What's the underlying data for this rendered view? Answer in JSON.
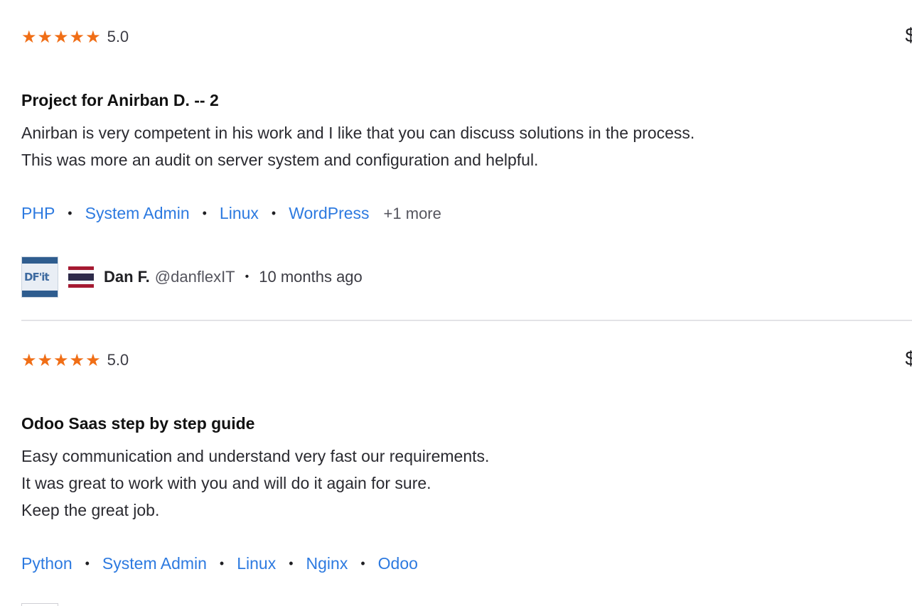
{
  "reviews": [
    {
      "rating_value": 5,
      "score": "5.0",
      "edge_text": "$",
      "title": "Project for Anirban D. -- 2",
      "body_lines": [
        "Anirban is very competent in his work and I like that you can discuss solutions in the process.",
        "This was more an audit on server system and configuration and helpful."
      ],
      "tags": [
        "PHP",
        "System Admin",
        "Linux",
        "WordPress"
      ],
      "more": "+1 more",
      "author": {
        "avatar_text": "DF'it",
        "flag": "thailand-flag",
        "name": "Dan F.",
        "handle": "@danflexIT",
        "time": "10 months ago"
      }
    },
    {
      "rating_value": 5,
      "score": "5.0",
      "edge_text": "$",
      "title": "Odoo Saas step by step guide",
      "body_lines": [
        "Easy communication and understand very fast our requirements.",
        "It was great to work with you and will do it again for sure.",
        "Keep the great job."
      ],
      "tags": [
        "Python",
        "System Admin",
        "Linux",
        "Nginx",
        "Odoo"
      ]
    }
  ],
  "colors": {
    "star": "#f06e16",
    "tag_link": "#2d7ae0",
    "flag_red": "#a51931",
    "flag_white": "#f4f5f8",
    "flag_blue": "#2d2a4a"
  }
}
